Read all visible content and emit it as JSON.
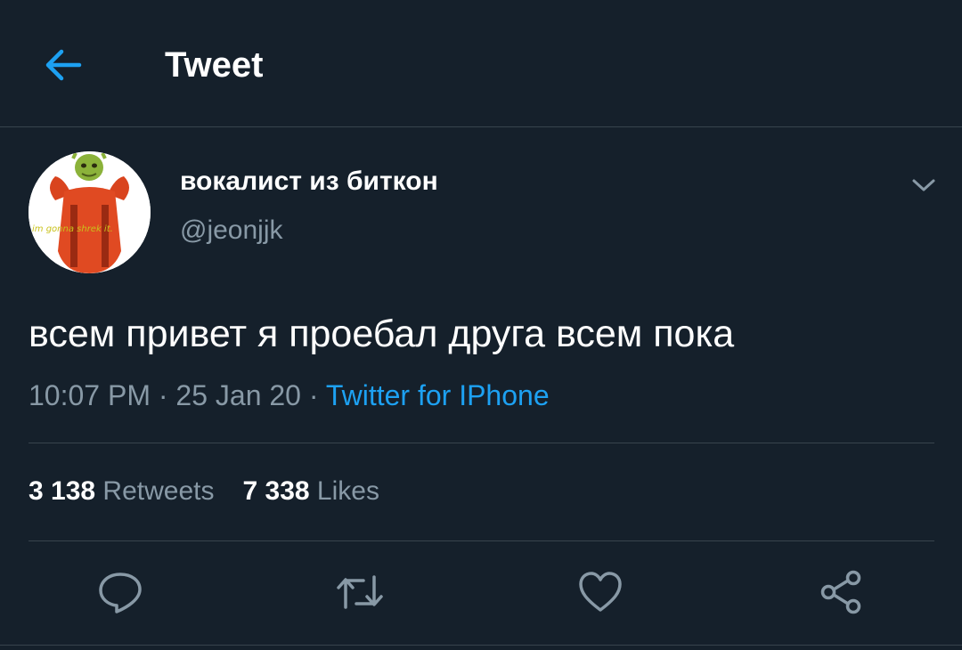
{
  "header": {
    "title": "Tweet",
    "back_icon": "arrow-left-icon"
  },
  "colors": {
    "background": "#15202b",
    "accent": "#1da1f2",
    "secondary_text": "#8899a6",
    "divider": "#38444d"
  },
  "tweet": {
    "author": {
      "display_name": "вокалист из биткон",
      "handle": "@jeonjjk",
      "avatar_caption": "im gonna shrek it."
    },
    "menu_icon": "chevron-down-icon",
    "text": "всем привет я проебал друга всем пока",
    "time": "10:07 PM",
    "separator": "·",
    "date": "25 Jan 20",
    "source": "Twitter for IPhone",
    "stats": {
      "retweets_count": "3 138",
      "retweets_label": "Retweets",
      "likes_count": "7 338",
      "likes_label": "Likes"
    },
    "actions": [
      {
        "icon": "reply-icon"
      },
      {
        "icon": "retweet-icon"
      },
      {
        "icon": "heart-icon"
      },
      {
        "icon": "share-icon"
      }
    ]
  }
}
